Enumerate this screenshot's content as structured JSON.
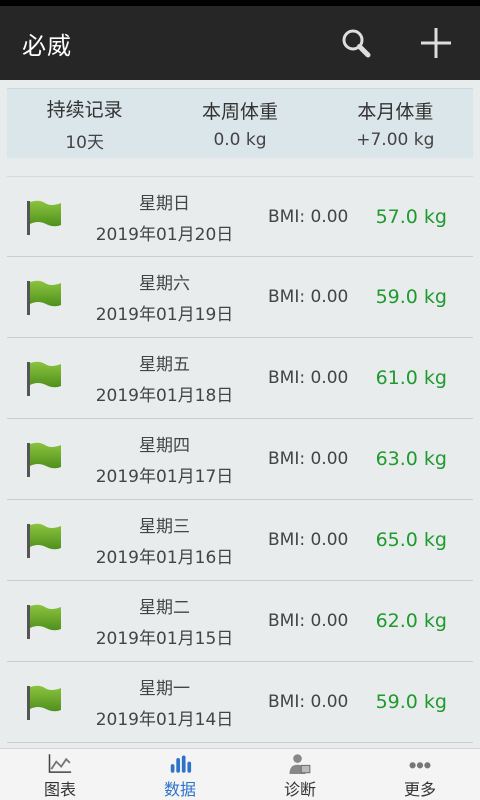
{
  "app": {
    "title": "必威"
  },
  "summary": [
    {
      "label": "持续记录",
      "value": "10天"
    },
    {
      "label": "本周体重",
      "value": "0.0 kg"
    },
    {
      "label": "本月体重",
      "value": "+7.00 kg"
    }
  ],
  "records": [
    {
      "weekday": "星期日",
      "date": "2019年01月20日",
      "bmi": "BMI: 0.00",
      "weight": "57.0 kg"
    },
    {
      "weekday": "星期六",
      "date": "2019年01月19日",
      "bmi": "BMI: 0.00",
      "weight": "59.0 kg"
    },
    {
      "weekday": "星期五",
      "date": "2019年01月18日",
      "bmi": "BMI: 0.00",
      "weight": "61.0 kg"
    },
    {
      "weekday": "星期四",
      "date": "2019年01月17日",
      "bmi": "BMI: 0.00",
      "weight": "63.0 kg"
    },
    {
      "weekday": "星期三",
      "date": "2019年01月16日",
      "bmi": "BMI: 0.00",
      "weight": "65.0 kg"
    },
    {
      "weekday": "星期二",
      "date": "2019年01月15日",
      "bmi": "BMI: 0.00",
      "weight": "62.0 kg"
    },
    {
      "weekday": "星期一",
      "date": "2019年01月14日",
      "bmi": "BMI: 0.00",
      "weight": "59.0 kg"
    }
  ],
  "nav": [
    {
      "label": "图表",
      "icon": "line-chart-icon"
    },
    {
      "label": "数据",
      "icon": "bar-chart-icon"
    },
    {
      "label": "诊断",
      "icon": "doctor-icon"
    },
    {
      "label": "更多",
      "icon": "more-dots-icon"
    }
  ],
  "colors": {
    "appbar": "#262626",
    "weight": "#1f9a2f",
    "active_nav": "#2f73c9",
    "flag": "#6aaa2a"
  }
}
